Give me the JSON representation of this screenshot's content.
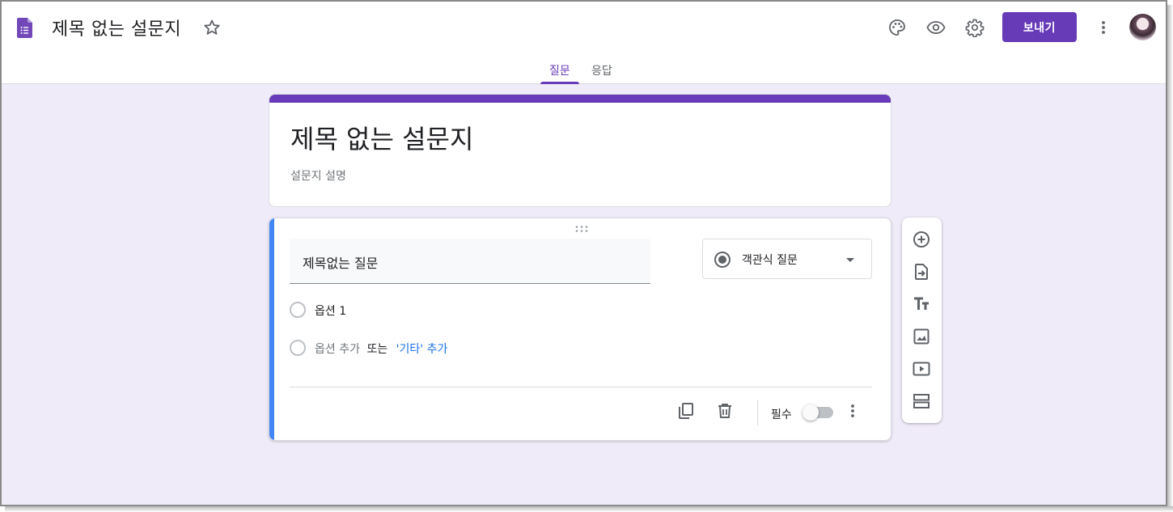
{
  "header": {
    "doc_title": "제목 없는 설문지",
    "send_label": "보내기",
    "icons": [
      "palette-icon",
      "preview-eye-icon",
      "settings-gear-icon",
      "more-vert-icon"
    ]
  },
  "tabs": [
    {
      "label": "질문",
      "active": true
    },
    {
      "label": "응답",
      "active": false
    }
  ],
  "form": {
    "title": "제목 없는 설문지",
    "description_placeholder": "설문지 설명"
  },
  "question": {
    "title": "제목없는 질문",
    "type": "객관식 질문",
    "options": [
      "옵션 1"
    ],
    "add_option": "옵션 추가",
    "or": "또는",
    "add_other": "'기타' 추가",
    "required_label": "필수",
    "required": false
  },
  "side_toolbar": [
    "add-question-icon",
    "import-questions-icon",
    "add-title-icon",
    "add-image-icon",
    "add-video-icon",
    "add-section-icon"
  ],
  "colors": {
    "accent": "#673ab7",
    "background": "#f0ebf8",
    "focus_bar": "#4285f4",
    "link": "#1a73e8"
  }
}
